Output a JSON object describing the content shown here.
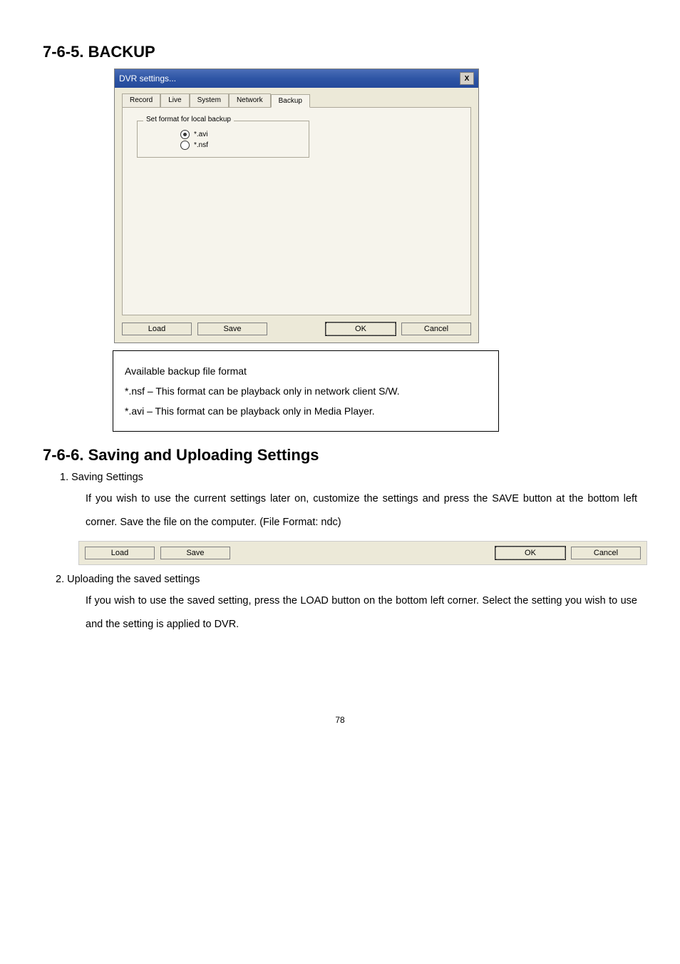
{
  "section1": {
    "heading": "7-6-5. BACKUP"
  },
  "dialog": {
    "title": "DVR settings...",
    "close": "X",
    "tabs": [
      "Record",
      "Live",
      "System",
      "Network",
      "Backup"
    ],
    "fieldset_title": "Set format for local backup",
    "radio_avi": "*.avi",
    "radio_nsf": "*.nsf",
    "load": "Load",
    "save": "Save",
    "ok": "OK",
    "cancel": "Cancel"
  },
  "infobox": {
    "line1": "Available backup file format",
    "line2": "*.nsf – This format can be playback only in network client S/W.",
    "line3": "*.avi – This format can be playback only in Media Player."
  },
  "section2": {
    "heading": "7-6-6. Saving and Uploading Settings",
    "sub1": "1. Saving Settings",
    "para1": "If you wish to use the current settings later on, customize the settings and press the SAVE button at the bottom left corner. Save the file on the computer. (File Format: ndc)",
    "sub2": "2. Uploading the saved settings",
    "para2": "If you wish to use the saved setting, press the LOAD button on the bottom left corner. Select the setting you wish to use and the setting is applied to DVR."
  },
  "strip": {
    "load": "Load",
    "save": "Save",
    "ok": "OK",
    "cancel": "Cancel"
  },
  "page_number": "78"
}
